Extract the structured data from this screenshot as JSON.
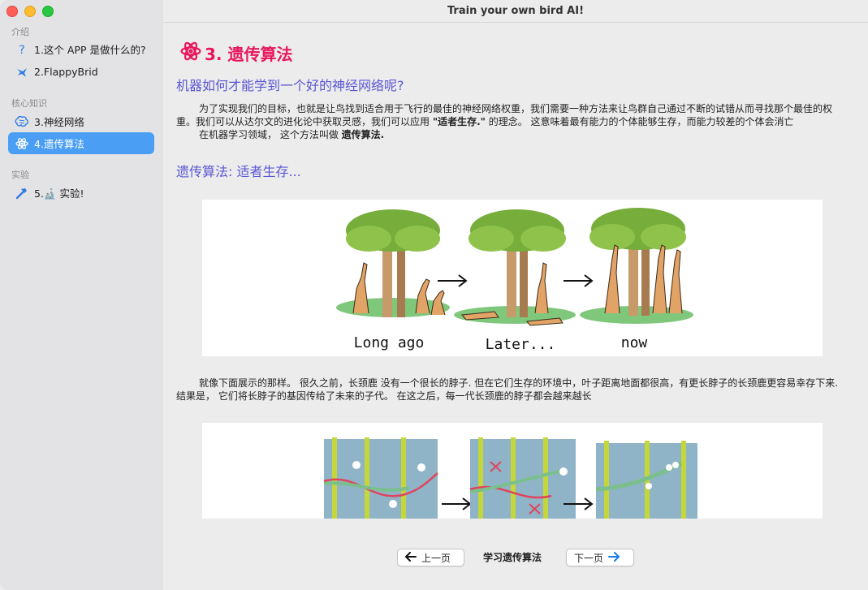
{
  "window": {
    "title": "Train your own bird AI!"
  },
  "sidebar": {
    "sections": [
      {
        "label": "介绍"
      },
      {
        "label": "核心知识"
      },
      {
        "label": "实验"
      }
    ],
    "items": [
      {
        "label": "1.这个 APP 是做什么的?",
        "icon": "question-icon"
      },
      {
        "label": "2.FlappyBrid",
        "icon": "bird-icon"
      },
      {
        "label": "3.神经网络",
        "icon": "brain-icon"
      },
      {
        "label": "4.遗传算法",
        "icon": "atom-icon",
        "active": true
      },
      {
        "label": "5.🔬 实验!",
        "icon": "hammer-icon"
      }
    ]
  },
  "main": {
    "heading": "3. 遗传算法",
    "question": "机器如何才能学到一个好的神经网络呢?",
    "p1_a": "为了实现我们的目标，也就是让鸟找到适合用于飞行的最佳的神经网络权重，我们需要一种方法来让鸟群自己通过不断的试错从而寻找那个最佳的权重。我们可以从达尔文的进化论中获取灵感，我们可以应用 ",
    "p1_bold": "\"适者生存.\"",
    "p1_b": " 的理念。 这意味着最有能力的个体能够生存，而能力较差的个体会消亡",
    "p2_a": "在机器学习领域， 这个方法叫做 ",
    "p2_bold": "遗传算法.",
    "subheading": "遗传算法: 适者生存...",
    "illustration1": {
      "captions": [
        "Long ago",
        "Later...",
        "now"
      ]
    },
    "p3": "就像下面展示的那样。 很久之前，长颈鹿 没有一个很长的脖子. 但在它们生存的环境中，叶子距离地面都很高，有更长脖子的长颈鹿更容易幸存下来. 结果是， 它们将长脖子的基因传给了未来的子代。 在这之后，每一代长颈鹿的脖子都会越来越长"
  },
  "footer": {
    "prev_label": "上一页",
    "page_title": "学习遗传算法",
    "next_label": "下一页"
  },
  "colors": {
    "accent": "#e8175d",
    "subtitle": "#5a56d4",
    "selection": "#4a9ff5",
    "next_arrow": "#1a7bea"
  }
}
